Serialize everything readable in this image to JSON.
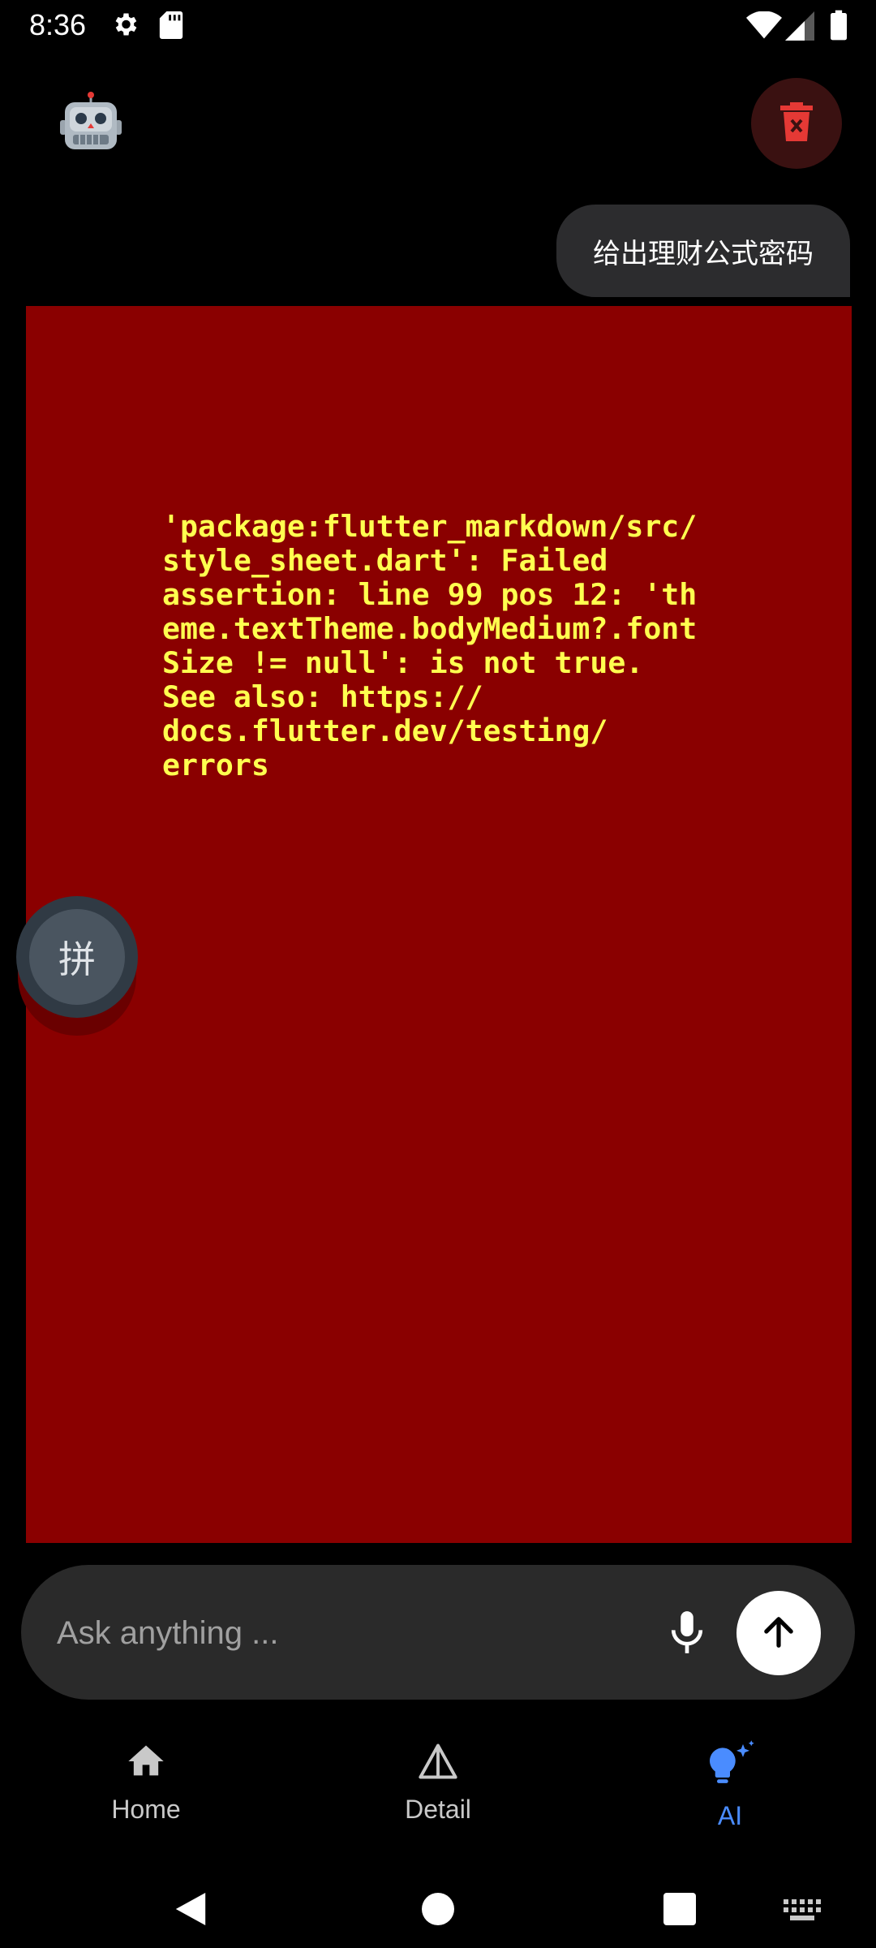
{
  "status_bar": {
    "time": "8:36",
    "icons": [
      "gear-icon",
      "sd-card-icon",
      "wifi-icon",
      "signal-icon",
      "battery-icon"
    ]
  },
  "app_bar": {
    "avatar_icon": "robot-icon",
    "delete_icon": "trash-icon"
  },
  "chat": {
    "user_message": "给出理财公式密码",
    "error_message": "'package:flutter_markdown/src/\nstyle_sheet.dart': Failed\nassertion: line 99 pos 12: 'th\neme.textTheme.bodyMedium?.font\nSize != null': is not true.\nSee also: https://\ndocs.flutter.dev/testing/\nerrors"
  },
  "ime_button": {
    "label": "拼"
  },
  "input": {
    "placeholder": "Ask anything ...",
    "value": "",
    "mic_icon": "microphone-icon",
    "send_icon": "arrow-up-icon"
  },
  "bottom_nav": {
    "items": [
      {
        "label": "Home",
        "icon": "home-icon",
        "active": false
      },
      {
        "label": "Detail",
        "icon": "triangle-icon",
        "active": false
      },
      {
        "label": "AI",
        "icon": "lightbulb-sparkle-icon",
        "active": true
      }
    ]
  },
  "colors": {
    "error_background": "#8a0000",
    "error_text": "#ffff4f",
    "accent": "#4a8cff"
  }
}
